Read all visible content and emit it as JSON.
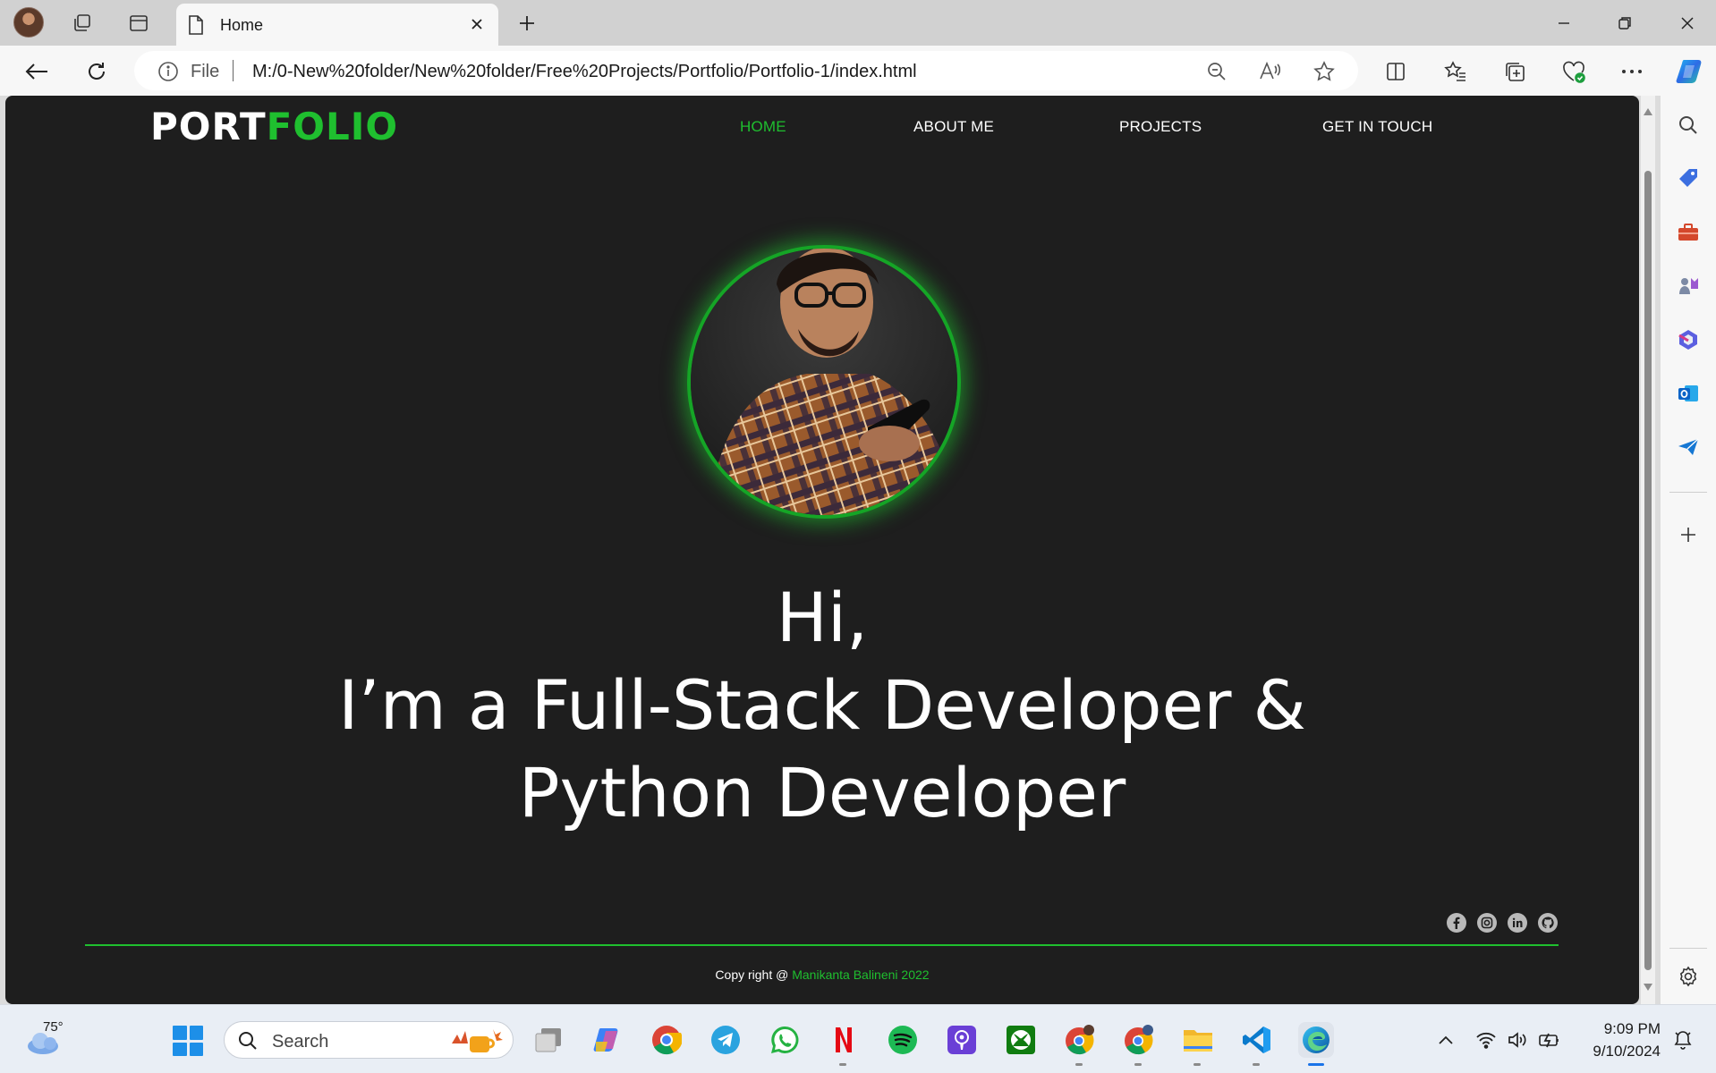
{
  "browser": {
    "tab_title": "Home",
    "address_prefix": "File",
    "url": "M:/0-New%20folder/New%20folder/Free%20Projects/Portfolio/Portfolio-1/index.html"
  },
  "site": {
    "logo_part1": "PORT",
    "logo_part2": "FOLIO",
    "nav": [
      "HOME",
      "ABOUT ME",
      "PROJECTS",
      "GET IN TOUCH"
    ],
    "active_nav": "HOME",
    "hero": {
      "line1": "Hi,",
      "line2": "I’m a Full-Stack Developer &",
      "line3": "Python Developer"
    },
    "socials": [
      "facebook-icon",
      "instagram-icon",
      "linkedin-icon",
      "github-icon"
    ],
    "footer_prefix": "Copy right @ ",
    "footer_name": "Manikanta Balineni 2022",
    "accent_color": "#1fbf2f",
    "background_color": "#1e1e1e"
  },
  "taskbar": {
    "weather_temp": "75°",
    "search_placeholder": "Search",
    "time": "9:09 PM",
    "date": "9/10/2024"
  }
}
